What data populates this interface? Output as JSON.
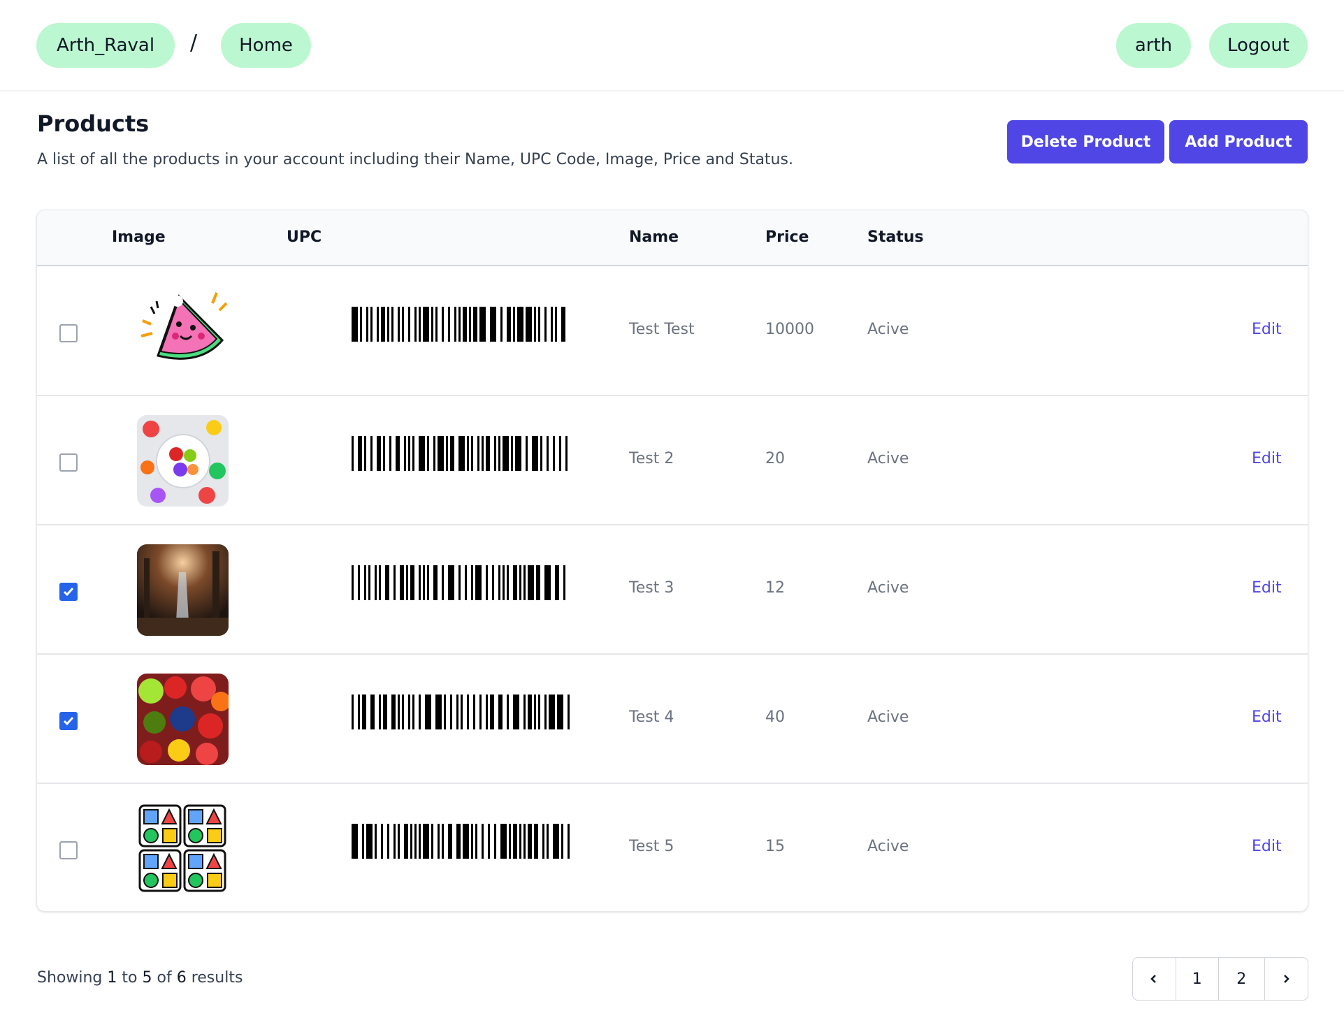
{
  "header": {
    "breadcrumb_user": "Arth_Raval",
    "breadcrumb_separator": "/",
    "breadcrumb_home": "Home",
    "account_name": "arth",
    "logout_label": "Logout"
  },
  "page": {
    "title": "Products",
    "description": "A list of all the products in your account including their Name, UPC Code, Image, Price and Status.",
    "delete_button": "Delete Product",
    "add_button": "Add Product"
  },
  "table": {
    "headers": {
      "image": "Image",
      "upc": "UPC",
      "name": "Name",
      "price": "Price",
      "status": "Status"
    },
    "edit_label": "Edit",
    "rows": [
      {
        "checked": false,
        "image": "watermelon-sticker",
        "name": "Test Test",
        "price": "10000",
        "status": "Acive"
      },
      {
        "checked": false,
        "image": "fruit-bowl-photo",
        "name": "Test 2",
        "price": "20",
        "status": "Acive"
      },
      {
        "checked": true,
        "image": "forest-waterfall-photo",
        "name": "Test 3",
        "price": "12",
        "status": "Acive"
      },
      {
        "checked": true,
        "image": "fruit-assortment-photo",
        "name": "Test 4",
        "price": "40",
        "status": "Acive"
      },
      {
        "checked": false,
        "image": "shapes-grid-icon",
        "name": "Test 5",
        "price": "15",
        "status": "Acive"
      }
    ]
  },
  "pagination": {
    "showing_prefix": "Showing",
    "from": "1",
    "to_word": "to",
    "to": "5",
    "of_word": "of",
    "total": "6",
    "suffix": "results",
    "pages": [
      "1",
      "2"
    ],
    "prev_icon": "chevron-left-icon",
    "next_icon": "chevron-right-icon"
  },
  "colors": {
    "pill": "#bbf7d0",
    "primary": "#4f46e5",
    "checkbox_checked": "#2563eb"
  }
}
